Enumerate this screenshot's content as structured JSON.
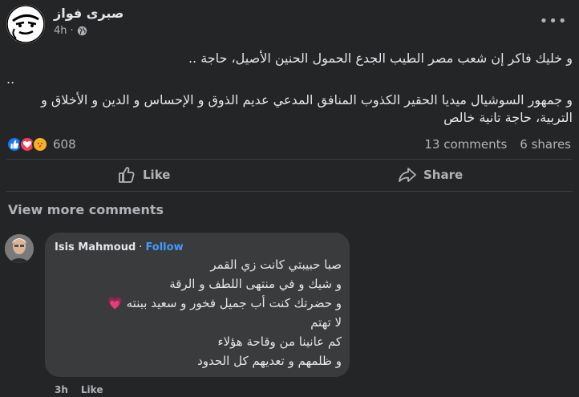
{
  "post": {
    "author": "صبرى فواز",
    "time": "4h",
    "separator": "·",
    "more_glyph": "•••",
    "line1": "و خليك فاكر إن شعب مصر الطيب الجدع الحمول الحنين الأصيل، حاجة ..",
    "line2": "..",
    "line3": "و جمهور السوشيال ميديا الحقير الكذوب المنافق المدعي عديم الذوق و الإحساس و الدين و الأخلاق و التربية، حاجة تانية خالص"
  },
  "stats": {
    "reaction_count": "608",
    "comments": "13 comments",
    "shares": "6 shares",
    "reactions": [
      "like-icon",
      "love-icon",
      "care-icon"
    ]
  },
  "actions": {
    "like_label": "Like",
    "share_label": "Share"
  },
  "view_more": "View more comments",
  "comment": {
    "author": "Isis Mahmoud",
    "dot": "·",
    "follow": "Follow",
    "lines": [
      "صبا حبيبتي كانت زي القمر",
      "و شيك و في منتهى اللطف و الرقة",
      "و حضرتك كنت أب جميل فخور و سعيد ببنته 💗",
      "لا تهتم",
      "كم عانينا من وقاحة هؤلاء",
      "و ظلمهم و تعديهم كل الحدود"
    ],
    "time": "3h",
    "like": "Like"
  },
  "colors": {
    "background": "#242526",
    "bubble": "#3a3b3c",
    "text": "#e4e6eb",
    "muted": "#b0b3b8",
    "link": "#4599ff"
  }
}
